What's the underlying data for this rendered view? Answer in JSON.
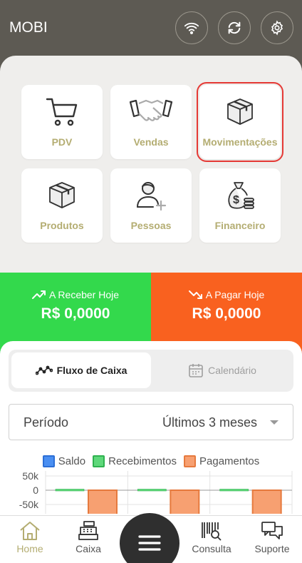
{
  "app": {
    "title": "MOBI"
  },
  "header": {
    "icons": [
      "wifi-icon",
      "sync-icon",
      "settings-icon"
    ]
  },
  "menu": {
    "tiles": [
      {
        "label": "PDV",
        "icon": "cart-icon"
      },
      {
        "label": "Vendas",
        "icon": "handshake-icon"
      },
      {
        "label": "Movimentações",
        "icon": "box-icon",
        "selected": true
      },
      {
        "label": "Produtos",
        "icon": "box-icon"
      },
      {
        "label": "Pessoas",
        "icon": "person-add-icon"
      },
      {
        "label": "Financeiro",
        "icon": "money-bag-icon"
      }
    ]
  },
  "summary": {
    "receive_label": "A Receber Hoje",
    "receive_value": "R$ 0,0000",
    "pay_label": "A Pagar Hoje",
    "pay_value": "R$ 0,0000"
  },
  "tabs": {
    "cashflow": "Fluxo de Caixa",
    "calendar": "Calendário"
  },
  "period": {
    "label": "Período",
    "value": "Últimos 3 meses"
  },
  "chart_data": {
    "type": "bar",
    "categories": [
      "",
      "",
      ""
    ],
    "series": [
      {
        "name": "Saldo",
        "values": [
          0,
          0,
          0
        ],
        "color": "#4a8ff2"
      },
      {
        "name": "Recebimentos",
        "values": [
          0,
          0,
          0
        ],
        "color": "#5ed87a"
      },
      {
        "name": "Pagamentos",
        "values": [
          -100000,
          -100000,
          -100000
        ],
        "color": "#f7a071"
      }
    ],
    "yticks": [
      "50k",
      "0",
      "-50k"
    ],
    "ylim": [
      -100000,
      50000
    ],
    "grid": true,
    "legend": "top"
  },
  "colors": {
    "accent": "#b4ad72",
    "receive": "#33d94c",
    "pay": "#f9611f",
    "header": "#5d5a53"
  },
  "nav": {
    "home": "Home",
    "caixa": "Caixa",
    "consulta": "Consulta",
    "suporte": "Suporte"
  }
}
